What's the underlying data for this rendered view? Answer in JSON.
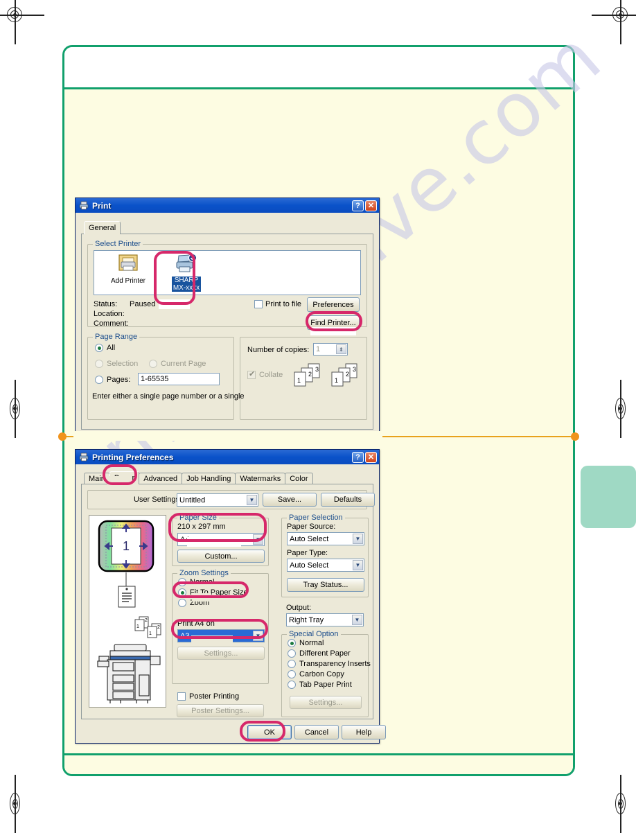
{
  "watermark": {
    "text": "manualsive.com"
  },
  "print_dialog": {
    "title": "Print",
    "title_icon": "printer-icon",
    "help_button": "?",
    "close_button": "✕",
    "tabs": [
      {
        "label": "General",
        "active": true
      }
    ],
    "select_printer": {
      "legend": "Select Printer",
      "printers": [
        {
          "name": "Add Printer",
          "icon": "add-printer-icon",
          "selected": false
        },
        {
          "name": "SHARP MX-xxxx",
          "name_line1": "SHARP",
          "name_line2": "MX-xxxx",
          "icon": "printer-default-icon",
          "selected": true
        }
      ],
      "status_label": "Status:",
      "status_value": "Paused",
      "location_label": "Location:",
      "location_value": "",
      "comment_label": "Comment:",
      "comment_value": "",
      "print_to_file_label": "Print to file",
      "print_to_file_checked": false,
      "preferences_button": "Preferences",
      "find_printer_button": "Find Printer..."
    },
    "page_range": {
      "legend": "Page Range",
      "options": [
        {
          "label": "All",
          "selected": true,
          "disabled": false
        },
        {
          "label": "Selection",
          "selected": false,
          "disabled": true
        },
        {
          "label": "Current Page",
          "selected": false,
          "disabled": true
        },
        {
          "label": "Pages:",
          "selected": false,
          "disabled": false
        }
      ],
      "pages_value": "1-65535",
      "hint": "Enter either a single page number or a single"
    },
    "copies": {
      "number_label": "Number of copies:",
      "number_value": "1",
      "collate_label": "Collate",
      "collate_checked": true,
      "collate_disabled": true,
      "page_marks": [
        "1",
        "2",
        "3",
        "1",
        "2",
        "3"
      ]
    }
  },
  "prefs_dialog": {
    "title": "Printing Preferences",
    "title_icon": "printer-icon",
    "help_button": "?",
    "close_button": "✕",
    "tabs": [
      {
        "label": "Main",
        "active": false
      },
      {
        "label": "Paper",
        "active": true
      },
      {
        "label": "Advanced",
        "active": false
      },
      {
        "label": "Job Handling",
        "active": false
      },
      {
        "label": "Watermarks",
        "active": false
      },
      {
        "label": "Color",
        "active": false
      }
    ],
    "user_settings": {
      "label": "User Settings:",
      "value": "Untitled",
      "save_button": "Save...",
      "defaults_button": "Defaults"
    },
    "paper_size": {
      "legend": "Paper Size",
      "dimensions": "210 x 297 mm",
      "value": "A4",
      "custom_button": "Custom..."
    },
    "zoom_settings": {
      "legend": "Zoom Settings",
      "options": [
        {
          "label": "Normal",
          "selected": false
        },
        {
          "label": "Fit To Paper Size",
          "selected": true
        },
        {
          "label": "Zoom",
          "selected": false
        }
      ],
      "print_on_label": "Print A4 on",
      "print_on_value": "A3",
      "settings_button": "Settings..."
    },
    "poster": {
      "checkbox_label": "Poster Printing",
      "checked": false,
      "settings_button": "Poster Settings..."
    },
    "paper_selection": {
      "legend": "Paper Selection",
      "source_label": "Paper Source:",
      "source_value": "Auto Select",
      "type_label": "Paper Type:",
      "type_value": "Auto Select",
      "tray_status_button": "Tray Status..."
    },
    "output": {
      "label": "Output:",
      "value": "Right Tray"
    },
    "special_option": {
      "legend": "Special Option",
      "options": [
        {
          "label": "Normal",
          "selected": true
        },
        {
          "label": "Different Paper",
          "selected": false
        },
        {
          "label": "Transparency Inserts",
          "selected": false
        },
        {
          "label": "Carbon Copy",
          "selected": false
        },
        {
          "label": "Tab Paper Print",
          "selected": false
        }
      ],
      "settings_button": "Settings..."
    },
    "preview": {
      "page_number": "1"
    },
    "footer_buttons": {
      "ok": "OK",
      "cancel": "Cancel",
      "help": "Help"
    }
  },
  "colors": {
    "frame_green": "#11a06c",
    "divider_orange": "#e8a21c",
    "highlight_pink": "#d6286a",
    "tab_teal": "#9fd9c4",
    "page_cream": "#fdfce2",
    "titlebar_blue": "#0a52c9"
  }
}
